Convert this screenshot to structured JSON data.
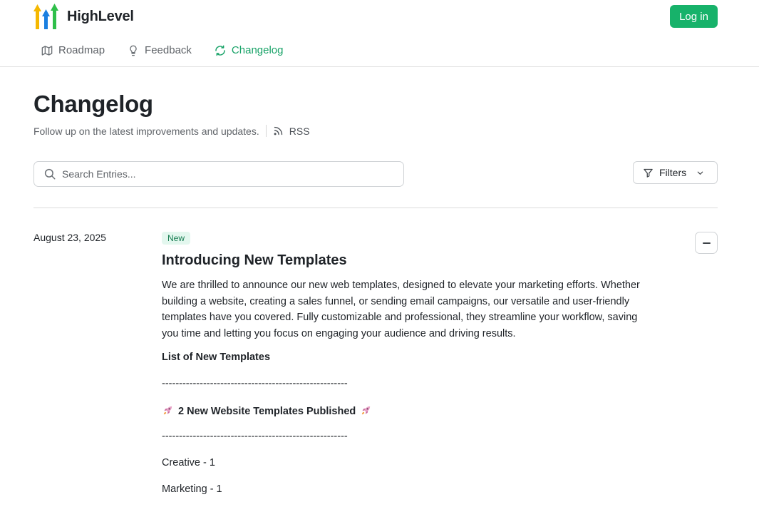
{
  "brand": {
    "name": "HighLevel",
    "colors": {
      "accent": "#17b26a",
      "arrow_yellow": "#f5b800",
      "arrow_blue": "#1a7fe0",
      "arrow_green": "#2fbf4a"
    }
  },
  "header": {
    "login_label": "Log in"
  },
  "nav": {
    "items": [
      {
        "label": "Roadmap",
        "icon": "map-icon",
        "active": false
      },
      {
        "label": "Feedback",
        "icon": "lightbulb-icon",
        "active": false
      },
      {
        "label": "Changelog",
        "icon": "refresh-icon",
        "active": true
      }
    ]
  },
  "page": {
    "title": "Changelog",
    "subtitle": "Follow up on the latest improvements and updates.",
    "rss_label": "RSS"
  },
  "search": {
    "placeholder": "Search Entries...",
    "value": ""
  },
  "filters": {
    "label": "Filters"
  },
  "entry": {
    "date": "August 23, 2025",
    "badge": "New",
    "title": "Introducing New Templates",
    "body": "We are thrilled to announce our new web templates, designed to elevate your marketing efforts. Whether building a website, creating a sales funnel, or sending email campaigns, our versatile and user-friendly templates have you covered. Fully customizable and professional, they streamline your workflow, saving you time and letting you focus on engaging your audience and driving results.",
    "list_heading": "List of New Templates",
    "separator": "------------------------------------------------------",
    "section_heading": "2 New Website Templates Published",
    "items": [
      "Creative - 1",
      "Marketing - 1"
    ]
  }
}
